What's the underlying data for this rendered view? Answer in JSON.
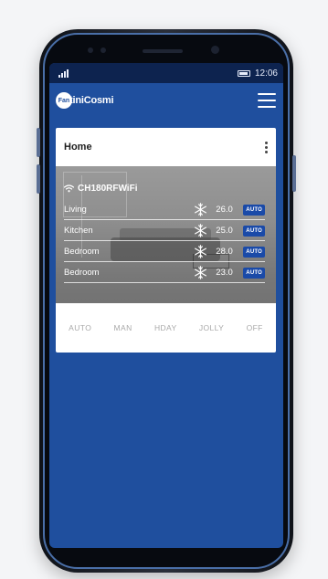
{
  "status_bar": {
    "time": "12:06"
  },
  "app_bar": {
    "logo_mark": "Fan",
    "logo_text": "tiniCosmi",
    "menu_icon": "hamburger-icon"
  },
  "card": {
    "title": "Home",
    "menu_icon": "kebab-icon",
    "device": {
      "wifi_icon": "wifi-icon",
      "name": "CH180RFWiFi"
    },
    "zones": [
      {
        "name": "Living",
        "mode_icon": "snowflake-icon",
        "temp": "26.0",
        "badge": "AUTO"
      },
      {
        "name": "Kitchen",
        "mode_icon": "snowflake-icon",
        "temp": "25.0",
        "badge": "AUTO"
      },
      {
        "name": "Bedroom",
        "mode_icon": "snowflake-icon",
        "temp": "28.0",
        "badge": "AUTO"
      },
      {
        "name": "Bedroom",
        "mode_icon": "snowflake-icon",
        "temp": "23.0",
        "badge": "AUTO"
      }
    ],
    "modes": [
      "AUTO",
      "MAN",
      "HDAY",
      "JOLLY",
      "OFF"
    ]
  },
  "colors": {
    "screen_bg": "#1f4f9e",
    "status_bar": "#0d234f",
    "badge": "#1a4aa8",
    "mode_text": "#a9a9a9"
  }
}
